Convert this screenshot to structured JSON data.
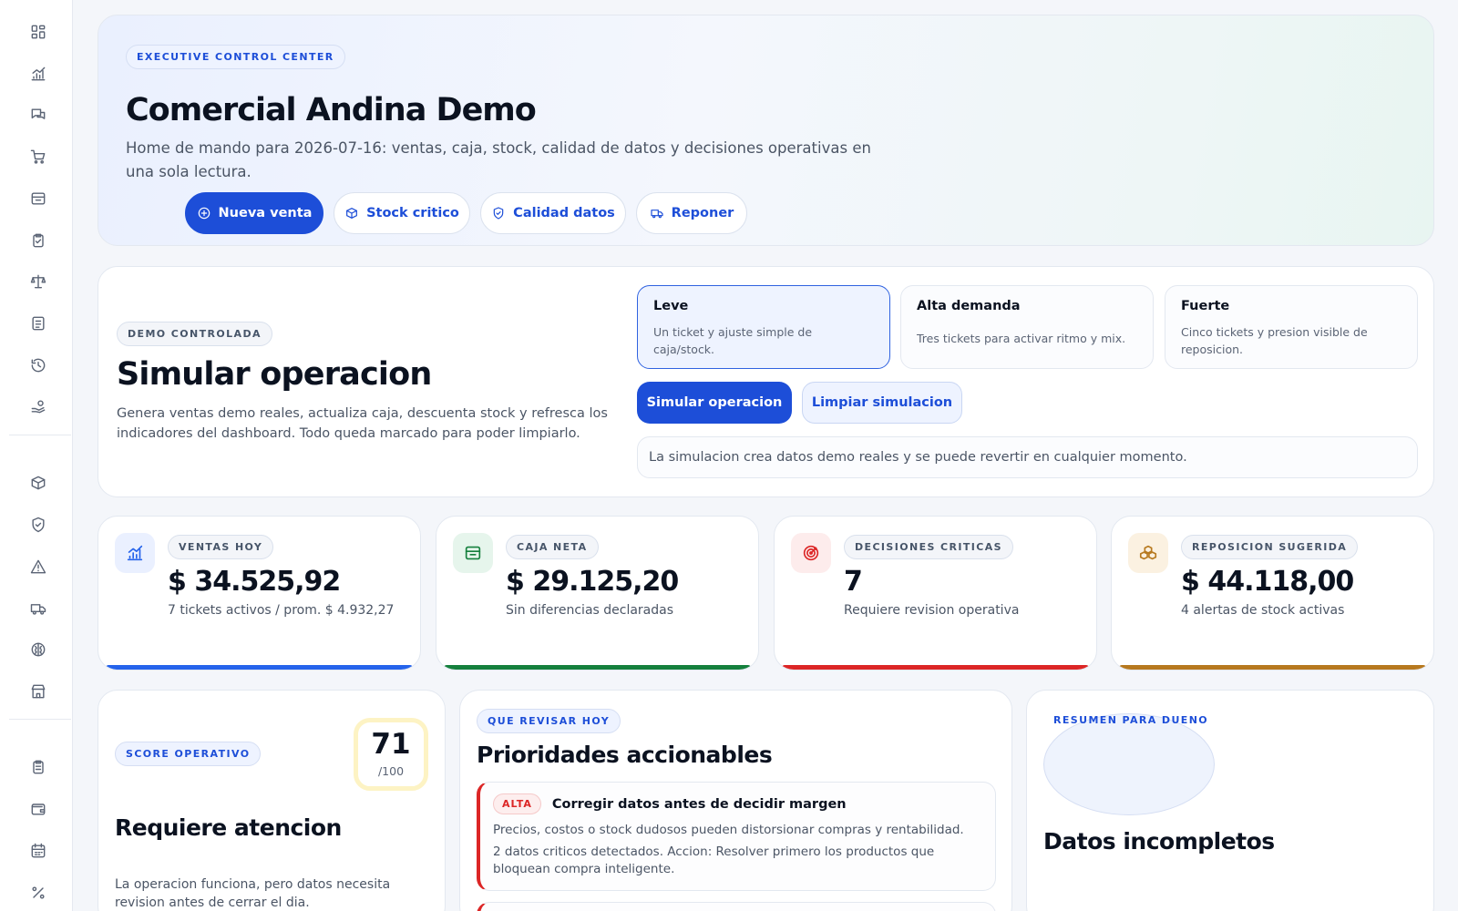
{
  "sidebar": {
    "icons": [
      "dashboard-icon",
      "chart-icon",
      "chat-icon",
      "cart-icon",
      "inbox-icon",
      "clipboard-icon",
      "scale-icon",
      "document-icon",
      "history-icon",
      "hand-coins-icon",
      "package-search-icon",
      "shield-check-icon",
      "alert-icon",
      "truck-icon",
      "brain-icon",
      "store-icon",
      "clipboard-list-icon",
      "wallet-icon",
      "calendar-icon",
      "percent-icon"
    ]
  },
  "hero": {
    "tag": "EXECUTIVE CONTROL CENTER",
    "title": "Comercial Andina Demo",
    "subtitle": "Home de mando para 2026-07-16: ventas, caja, stock, calidad de datos y decisiones operativas en una sola lectura.",
    "buttons": [
      {
        "label": "Nueva venta",
        "icon": "plus-circle-icon"
      },
      {
        "label": "Stock critico",
        "icon": "package-icon"
      },
      {
        "label": "Calidad datos",
        "icon": "shield-icon"
      },
      {
        "label": "Reponer",
        "icon": "truck-icon"
      }
    ]
  },
  "simulation": {
    "tag": "DEMO CONTROLADA",
    "title": "Simular operacion",
    "subtitle": "Genera ventas demo reales, actualiza caja, descuenta stock y refresca los indicadores del dashboard. Todo queda marcado para poder limpiarlo.",
    "options": [
      {
        "title": "Leve",
        "desc": "Un ticket y ajuste simple de caja/stock.",
        "selected": true
      },
      {
        "title": "Alta demanda",
        "desc": "Tres tickets para activar ritmo y mix.",
        "selected": false
      },
      {
        "title": "Fuerte",
        "desc": "Cinco tickets y presion visible de reposicion.",
        "selected": false
      }
    ],
    "primary_label": "Simular operacion",
    "secondary_label": "Limpiar simulacion",
    "note": "La simulacion crea datos demo reales y se puede revertir en cualquier momento."
  },
  "kpis": [
    {
      "label": "VENTAS HOY",
      "value": "$ 34.525,92",
      "sub": "7 tickets activos / prom. $ 4.932,27",
      "color": "#2563eb",
      "bg": "#eaf0ff",
      "icon": "chart-icon"
    },
    {
      "label": "CAJA NETA",
      "value": "$ 29.125,20",
      "sub": "Sin diferencias declaradas",
      "color": "#15803d",
      "bg": "#e6f5ec",
      "icon": "wallet-icon"
    },
    {
      "label": "DECISIONES CRITICAS",
      "value": "7",
      "sub": "Requiere revision operativa",
      "color": "#dc2626",
      "bg": "#fdecec",
      "icon": "target-icon"
    },
    {
      "label": "REPOSICION SUGERIDA",
      "value": "$ 44.118,00",
      "sub": "4 alertas de stock activas",
      "color": "#b7791f",
      "bg": "#fbf1e1",
      "icon": "boxes-icon"
    }
  ],
  "score": {
    "tag": "SCORE OPERATIVO",
    "value": "71",
    "max": "/100",
    "title": "Requiere atencion",
    "desc": "La operacion funciona, pero datos necesita revision antes de cerrar el dia."
  },
  "priorities": {
    "tag": "QUE REVISAR HOY",
    "title": "Prioridades accionables",
    "items": [
      {
        "level": "ALTA",
        "title": "Corregir datos antes de decidir margen",
        "desc": "Precios, costos o stock dudosos pueden distorsionar compras y rentabilidad.",
        "action": "2 datos criticos detectados. Accion: Resolver primero los productos que bloquean compra inteligente."
      }
    ]
  },
  "owner": {
    "tag": "RESUMEN PARA DUENO",
    "title": "Datos incompletos"
  }
}
